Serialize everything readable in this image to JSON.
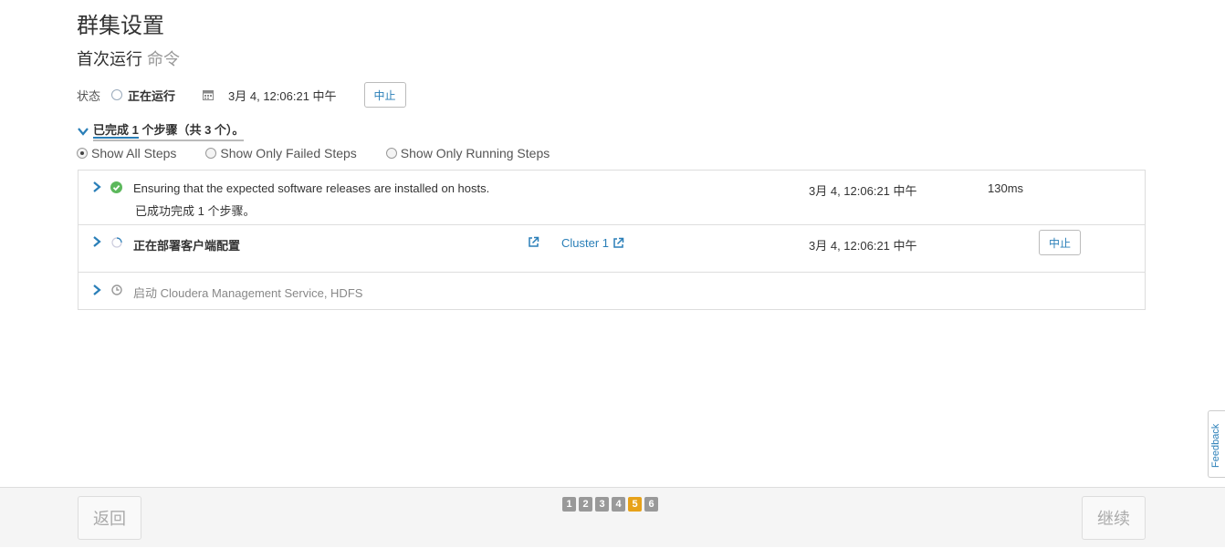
{
  "header": {
    "title": "群集设置",
    "subtitle_main": "首次运行",
    "subtitle_muted": "命令"
  },
  "status": {
    "label": "状态",
    "value": "正在运行",
    "date": "3月 4, 12:06:21 中午",
    "abort_label": "中止"
  },
  "progress": {
    "text_completed": "已完成 1",
    "text_rest": " 个步骤（共 3 个）。"
  },
  "filters": [
    {
      "label": "Show All Steps",
      "checked": true
    },
    {
      "label": "Show Only Failed Steps",
      "checked": false
    },
    {
      "label": "Show Only Running Steps",
      "checked": false
    }
  ],
  "steps": [
    {
      "title": "Ensuring that the expected software releases are installed on hosts.",
      "subtitle": "已成功完成  1  个步骤。",
      "time": "3月 4, 12:06:21 中午",
      "duration": "130ms",
      "state": "success"
    },
    {
      "title": "正在部署客户端配置",
      "link": "Cluster 1",
      "time": "3月 4, 12:06:21 中午",
      "abort_label": "中止",
      "state": "running"
    },
    {
      "title": "启动 Cloudera Management Service, HDFS",
      "state": "pending"
    }
  ],
  "footer": {
    "back_label": "返回",
    "continue_label": "继续",
    "pages": [
      "1",
      "2",
      "3",
      "4",
      "5",
      "6"
    ],
    "active_page": "5"
  },
  "feedback_label": "Feedback",
  "colors": {
    "accent": "#2a7fb8",
    "success": "#5cb85c",
    "active_page": "#e7a21a"
  },
  "icons": [
    "calendar-icon",
    "check-circle-icon",
    "spinner-icon",
    "clock-icon",
    "external-link-icon",
    "chevron-right-icon",
    "chevron-down-icon"
  ]
}
